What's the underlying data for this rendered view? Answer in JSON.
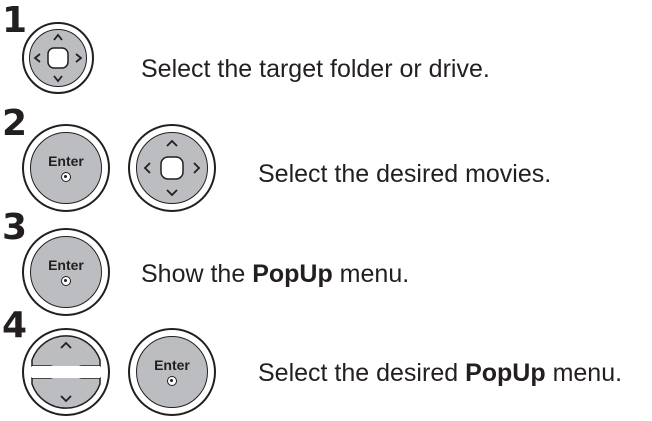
{
  "steps": [
    {
      "number": "1",
      "buttons": [
        "navigation-dpad"
      ],
      "text": "Select the target folder or drive."
    },
    {
      "number": "2",
      "buttons": [
        "enter",
        "navigation-dpad"
      ],
      "text": "Select the desired movies."
    },
    {
      "number": "3",
      "buttons": [
        "enter"
      ],
      "text_before": "Show the ",
      "text_bold": "PopUp",
      "text_after": " menu."
    },
    {
      "number": "4",
      "buttons": [
        "up-down-keys",
        "enter"
      ],
      "text_before": "Select the desired ",
      "text_bold": "PopUp",
      "text_after": " menu."
    }
  ],
  "enter_label": "Enter",
  "colors": {
    "text": "#231f20",
    "button_fill": "#bcbdc0",
    "background": "#ffffff"
  }
}
